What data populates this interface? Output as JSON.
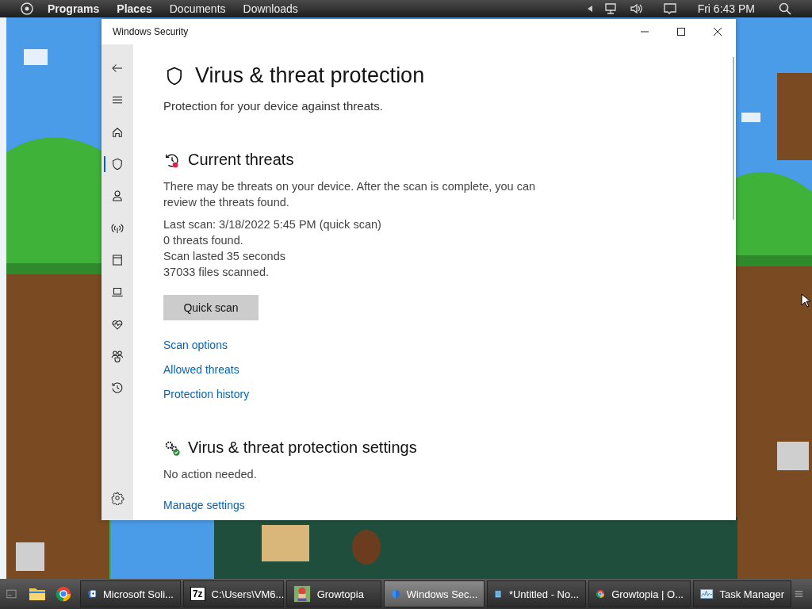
{
  "top_bar": {
    "menus": [
      {
        "label": "Programs",
        "bold": true
      },
      {
        "label": "Places",
        "bold": true
      },
      {
        "label": "Documents",
        "bold": false
      },
      {
        "label": "Downloads",
        "bold": false
      }
    ],
    "tray": [
      {
        "kind": "expand"
      },
      {
        "kind": "network"
      },
      {
        "kind": "volume"
      },
      {
        "kind": "notifications"
      }
    ],
    "clock": "Fri 6:43 PM"
  },
  "window": {
    "title": "Windows Security",
    "sidebar": {
      "nav": [
        {
          "kind": "back"
        },
        {
          "kind": "menu"
        }
      ],
      "items": [
        {
          "kind": "home",
          "selected": false
        },
        {
          "kind": "shield",
          "selected": true
        },
        {
          "kind": "person",
          "selected": false
        },
        {
          "kind": "wireless",
          "selected": false
        },
        {
          "kind": "browser",
          "selected": false
        },
        {
          "kind": "laptop",
          "selected": false
        },
        {
          "kind": "heart",
          "selected": false
        },
        {
          "kind": "family",
          "selected": false
        },
        {
          "kind": "history",
          "selected": false
        }
      ],
      "footer": [
        {
          "kind": "settings"
        }
      ]
    },
    "page": {
      "title": "Virus & threat protection",
      "subtitle": "Protection for your device against threats.",
      "sections": [
        {
          "kind": "threats",
          "title": "Current threats",
          "description": "There may be threats on your device. After the scan is complete, you can review the threats found.",
          "details": [
            "Last scan: 3/18/2022 5:45 PM (quick scan)",
            "0 threats found.",
            "Scan lasted 35 seconds",
            "37033 files scanned."
          ],
          "button": "Quick scan",
          "links": [
            "Scan options",
            "Allowed threats",
            "Protection history"
          ]
        },
        {
          "kind": "settings",
          "title": "Virus & threat protection settings",
          "description": "No action needed.",
          "links": [
            "Manage settings"
          ]
        }
      ]
    }
  },
  "taskbar": {
    "launchers": [
      {
        "kind": "desktop"
      },
      {
        "kind": "folder"
      },
      {
        "kind": "chrome"
      }
    ],
    "tasks": [
      {
        "kind": "cards",
        "label": "Microsoft Soli...",
        "selected": false
      },
      {
        "kind": "archive",
        "icon_text": "7z",
        "label": "C:\\Users\\VM6...",
        "selected": false
      },
      {
        "kind": "game",
        "label": "Growtopia",
        "selected": false
      },
      {
        "kind": "shield",
        "label": "Windows Sec...",
        "selected": true
      },
      {
        "kind": "notepad",
        "label": "*Untitled - No...",
        "selected": false
      },
      {
        "kind": "chrome",
        "label": "Growtopia | O...",
        "selected": false
      },
      {
        "kind": "monitor",
        "label": "Task Manager",
        "selected": false
      }
    ]
  }
}
